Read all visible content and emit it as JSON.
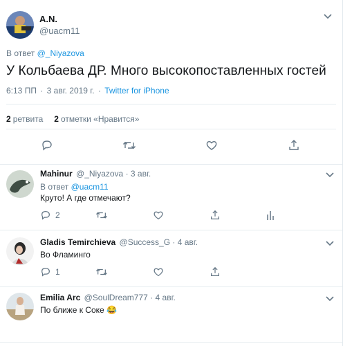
{
  "tweet": {
    "author_name": "A.N.",
    "author_handle": "@uacm11",
    "reply_prefix": "В ответ",
    "reply_to": "@_Niyazova",
    "text": "У Кольбаева ДР. Много высокопоставленных гостей",
    "time": "6:13 ПП",
    "date": "3 авг. 2019 г.",
    "dot": "·",
    "source": "Twitter for iPhone",
    "retweets_count": "2",
    "retweets_label": "ретвита",
    "likes_count": "2",
    "likes_label": "отметки «Нравится»"
  },
  "replies": [
    {
      "name": "Mahinur",
      "handle": "@_Niyazova",
      "dot": "·",
      "date": "3 авг.",
      "reply_prefix": "В ответ",
      "reply_to": "@uacm11",
      "text": "Круто! А где отмечают?",
      "reply_count": "2"
    },
    {
      "name": "Gladis Temirchieva",
      "handle": "@Success_G",
      "dot": "·",
      "date": "4 авг.",
      "text": "Во Фламинго",
      "reply_count": "1"
    },
    {
      "name": "Emilia Arc",
      "handle": "@SoulDream777",
      "dot": "·",
      "date": "4 авг.",
      "text": "По ближе к Соке 😂"
    }
  ],
  "icons": {
    "reply": "reply-icon",
    "retweet": "retweet-icon",
    "like": "like-icon",
    "share": "share-icon",
    "analytics": "analytics-icon",
    "chevron": "chevron-down-icon"
  },
  "colors": {
    "link": "#1b95e0",
    "muted": "#657786",
    "text": "#14171a",
    "divider": "#e6ecf0"
  }
}
